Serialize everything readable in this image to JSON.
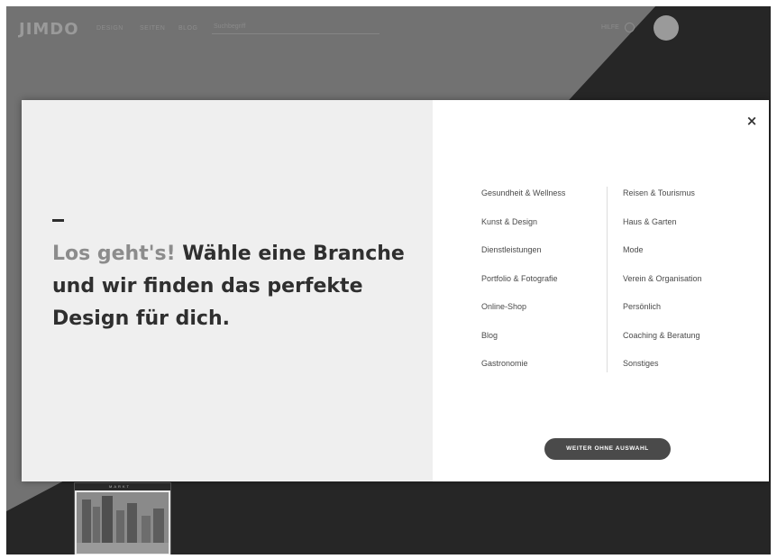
{
  "topbar": {
    "logo": "JIMDO",
    "nav": [
      "Design",
      "Seiten",
      "Blog"
    ],
    "search_placeholder": "Suchbegriff",
    "help": "HILFE"
  },
  "thumbnail": {
    "header": "MARKT"
  },
  "modal": {
    "dash": "–",
    "headline_accent": "Los geht's!",
    "headline_rest": " Wähle eine Branche und wir finden das perfekte Design für dich.",
    "close": "×",
    "categories_left": [
      "Gesundheit & Wellness",
      "Kunst & Design",
      "Dienstleistungen",
      "Portfolio & Fotografie",
      "Online-Shop",
      "Blog",
      "Gastronomie"
    ],
    "categories_right": [
      "Reisen & Tourismus",
      "Haus & Garten",
      "Mode",
      "Verein & Organisation",
      "Persönlich",
      "Coaching & Beratung",
      "Sonstiges"
    ],
    "skip_button": "WEITER OHNE AUSWAHL"
  },
  "colors": {
    "overlay": "#6e6e6e",
    "dark_triangle": "#262626",
    "modal_left": "#efefef",
    "modal_right": "#ffffff",
    "button": "#4a4a4a"
  }
}
